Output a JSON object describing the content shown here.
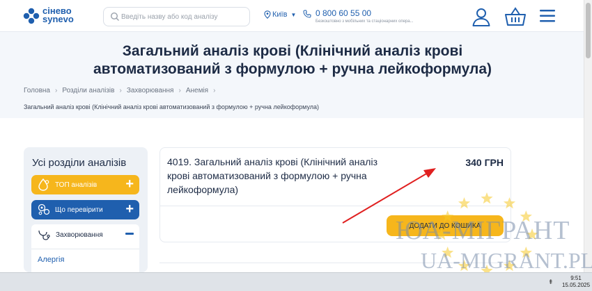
{
  "header": {
    "logo_line1": "сінево",
    "logo_line2": "synevo",
    "search_placeholder": "Введіть назву або код аналізу",
    "city": "Київ",
    "phone": "0 800 60 55 00",
    "phone_note": "Безкоштовно з мобільних та стаціонарних опера..."
  },
  "page": {
    "title": "Загальний аналіз крові (Клінічний аналіз крові автоматизований з формулою + ручна лейкоформула)",
    "breadcrumb": [
      "Головна",
      "Розділи аналізів",
      "Захворювання",
      "Анемія"
    ],
    "breadcrumb_current": "Загальний аналіз крові (Клінічний аналіз крові автоматизований з формулою + ручна лейкоформула)"
  },
  "sidebar": {
    "title": "Усі розділи аналізів",
    "top_label": "ТОП аналізів",
    "check_label": "Що перевірити",
    "section_label": "Захворювання",
    "first_item": "Алергія"
  },
  "card": {
    "title": "4019. Загальний аналіз крові (Клінічний аналіз крові автоматизований з формулою + ручна лейкоформула)",
    "price": "340 ГРН",
    "button": "ДОДАТИ ДО КОШИКА"
  },
  "watermark": {
    "line1": "ЮА-МІГРАНТ",
    "line2": "UA-MIGRANT.PL"
  },
  "taskbar": {
    "time": "9:51",
    "date": "15.05.2025"
  },
  "colors": {
    "brand_blue": "#1f5fae",
    "accent_yellow": "#f6b61c",
    "arrow_red": "#e02020"
  }
}
